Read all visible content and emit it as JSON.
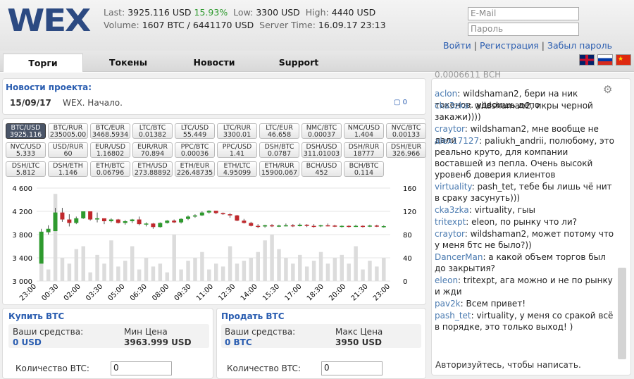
{
  "logo": "WEX",
  "stats": {
    "last_label": "Last:",
    "last": "3925.116 USD",
    "change": "15.93%",
    "low_label": "Low:",
    "low": "3300 USD",
    "high_label": "High:",
    "high": "4440 USD",
    "volume_label": "Volume:",
    "volume": "1607 BTC / 6441170 USD",
    "time_label": "Server Time:",
    "time": "16.09.17 23:13"
  },
  "login": {
    "email_placeholder": "E-Mail",
    "password_placeholder": "Пароль",
    "enter": "Войти",
    "register": "Регистрация",
    "forgot": "Забыл пароль",
    "sep": "|"
  },
  "tabs": [
    "Торги",
    "Токены",
    "Новости",
    "Support"
  ],
  "news": {
    "title": "Новости проекта:",
    "date": "15/09/17",
    "text": "WEX. Начало.",
    "comments": "0"
  },
  "pairs": [
    [
      "BTC/USD",
      "3925.116"
    ],
    [
      "BTC/RUR",
      "235005.00"
    ],
    [
      "BTC/EUR",
      "3468.5934"
    ],
    [
      "LTC/BTC",
      "0.01382"
    ],
    [
      "LTC/USD",
      "55.449"
    ],
    [
      "LTC/RUR",
      "3300.01"
    ],
    [
      "LTC/EUR",
      "46.658"
    ],
    [
      "NMC/BTC",
      "0.00037"
    ],
    [
      "NMC/USD",
      "1.404"
    ],
    [
      "NVC/BTC",
      "0.00133"
    ],
    [
      "NVC/USD",
      "5.333"
    ],
    [
      "USD/RUR",
      "60"
    ],
    [
      "EUR/USD",
      "1.16802"
    ],
    [
      "EUR/RUR",
      "70.894"
    ],
    [
      "PPC/BTC",
      "0.00036"
    ],
    [
      "PPC/USD",
      "1.41"
    ],
    [
      "DSH/BTC",
      "0.0787"
    ],
    [
      "DSH/USD",
      "311.01003"
    ],
    [
      "DSH/RUR",
      "18777"
    ],
    [
      "DSH/EUR",
      "326.966"
    ],
    [
      "DSH/LTC",
      "5.812"
    ],
    [
      "DSH/ETH",
      "1.146"
    ],
    [
      "ETH/BTC",
      "0.06796"
    ],
    [
      "ETH/USD",
      "273.88892"
    ],
    [
      "ETH/EUR",
      "226.48735"
    ],
    [
      "ETH/LTC",
      "4.95099"
    ],
    [
      "ETH/RUR",
      "15900.067"
    ],
    [
      "BCH/USD",
      "452"
    ],
    [
      "BCH/BTC",
      "0.114"
    ]
  ],
  "chart_data": {
    "type": "candlestick",
    "x": [
      "23:00",
      "00:30",
      "02:00",
      "03:30",
      "05:00",
      "06:30",
      "08:00",
      "09:30",
      "11:00",
      "12:30",
      "14:00",
      "15:30",
      "17:00",
      "18:30",
      "20:00",
      "21:30",
      "23:00"
    ],
    "ylim": [
      3000,
      4600
    ],
    "yticks": [
      "4 600",
      "4 200",
      "3 800",
      "3 400",
      "3 000"
    ],
    "vol_lim": [
      0,
      160
    ],
    "vol_ticks": [
      "160",
      "120",
      "80",
      "40",
      "0"
    ],
    "candles": [
      [
        3300,
        3900,
        3350,
        3850
      ],
      [
        3840,
        3960,
        3800,
        3900
      ],
      [
        3860,
        4260,
        3860,
        4180
      ],
      [
        4180,
        4260,
        4020,
        4060
      ],
      [
        4060,
        4150,
        3940,
        4000
      ],
      [
        4000,
        4110,
        3980,
        4080
      ],
      [
        4080,
        4200,
        4070,
        4200
      ],
      [
        4200,
        4150,
        4040,
        4060
      ],
      [
        4060,
        4180,
        4010,
        4080
      ],
      [
        4080,
        4060,
        3980,
        4030
      ],
      [
        4030,
        4080,
        4010,
        4060
      ],
      [
        4060,
        4070,
        3990,
        4000
      ],
      [
        4000,
        4050,
        3970,
        4030
      ],
      [
        4030,
        4070,
        4000,
        4060
      ],
      [
        4060,
        4110,
        3960,
        3980
      ],
      [
        3980,
        4010,
        3940,
        3990
      ],
      [
        3990,
        4000,
        3900,
        3930
      ],
      [
        3930,
        4010,
        3920,
        4000
      ],
      [
        4000,
        4050,
        3990,
        4040
      ],
      [
        4040,
        4060,
        4000,
        4010
      ],
      [
        4010,
        4080,
        3990,
        4070
      ],
      [
        4070,
        4130,
        4050,
        4110
      ],
      [
        4110,
        4150,
        4090,
        4130
      ],
      [
        4130,
        4200,
        4120,
        4180
      ],
      [
        4180,
        4220,
        4160,
        4210
      ],
      [
        4210,
        4200,
        4150,
        4170
      ],
      [
        4170,
        4180,
        4140,
        4150
      ],
      [
        4150,
        4170,
        4090,
        4130
      ],
      [
        4130,
        4140,
        4030,
        4040
      ],
      [
        4040,
        4070,
        3990,
        4000
      ],
      [
        4000,
        4020,
        3940,
        3950
      ],
      [
        3950,
        3980,
        3910,
        3940
      ],
      [
        3940,
        3970,
        3920,
        3960
      ],
      [
        3960,
        3980,
        3930,
        3950
      ],
      [
        3950,
        3970,
        3930,
        3955
      ],
      [
        3955,
        3990,
        3940,
        3960
      ],
      [
        3960,
        3980,
        3930,
        3945
      ],
      [
        3945,
        3990,
        3940,
        3970
      ],
      [
        3970,
        3980,
        3930,
        3950
      ],
      [
        3950,
        3980,
        3920,
        3945
      ],
      [
        3945,
        3970,
        3930,
        3960
      ],
      [
        3960,
        3990,
        3940,
        3955
      ],
      [
        3955,
        3970,
        3930,
        3945
      ],
      [
        3945,
        3960,
        3920,
        3950
      ],
      [
        3950,
        3960,
        3920,
        3940
      ],
      [
        3940,
        3970,
        3930,
        3950
      ],
      [
        3950,
        3960,
        3920,
        3945
      ],
      [
        3945,
        3970,
        3930,
        3955
      ],
      [
        3955,
        3970,
        3930,
        3940
      ],
      [
        3940,
        3960,
        3920,
        3945
      ]
    ],
    "volumes": [
      60,
      20,
      150,
      40,
      30,
      55,
      60,
      15,
      45,
      30,
      70,
      25,
      35,
      60,
      20,
      40,
      25,
      30,
      15,
      80,
      20,
      35,
      40,
      50,
      20,
      30,
      25,
      60,
      30,
      35,
      40,
      50,
      70,
      80,
      55,
      40,
      30,
      45,
      25,
      35,
      50,
      30,
      40,
      45,
      30,
      60,
      20,
      35,
      25,
      40
    ]
  },
  "buy": {
    "title": "Купить BTC",
    "funds_label": "Ваши средства:",
    "funds": "0 USD",
    "price_label": "Мин Цена",
    "price": "3963.999 USD",
    "qty_label": "Количество BTC:",
    "qty": "0"
  },
  "sell": {
    "title": "Продать BTC",
    "funds_label": "Ваши средства:",
    "funds": "0 BTC",
    "price_label": "Макс Цена",
    "price": "3950 USD",
    "qty_label": "Количество BTC:",
    "qty": "0"
  },
  "chat": {
    "top": "0.0006611 BCH",
    "messages": [
      [
        "aclon",
        "wildshaman2, бери на ник токенов. удвоишь депо"
      ],
      [
        "cka3zka",
        "wildshaman2, икры черной закажи))))"
      ],
      [
        "craytor",
        "wildshaman2, мне вообще не дали"
      ],
      [
        "alex17127",
        "paliukh_andrii, полюбому, это реально круто, для компании воставшей из пепла. Очень высокй уровенб доверия клиентов"
      ],
      [
        "virtuality",
        "pash_tet, тебе бы лишь чё нит в сраку засунуть)))"
      ],
      [
        "cka3zka",
        "virtuality, гыы"
      ],
      [
        "tritexpt",
        "eleon, по рынку что ли?"
      ],
      [
        "craytor",
        "wildshaman2, может потому что у меня бтс не было?))"
      ],
      [
        "DancerMan",
        "а какой объем торгов был до закрытия?"
      ],
      [
        "eleon",
        "tritexpt, ага можно и не по рынку и жди"
      ],
      [
        "pav2k",
        "Всем привет!"
      ],
      [
        "pash_tet",
        "virtuality, у меня со сракой всё в порядке, это только выход! )"
      ]
    ],
    "login_prompt": "Авторизуйтесь, чтобы написать."
  }
}
